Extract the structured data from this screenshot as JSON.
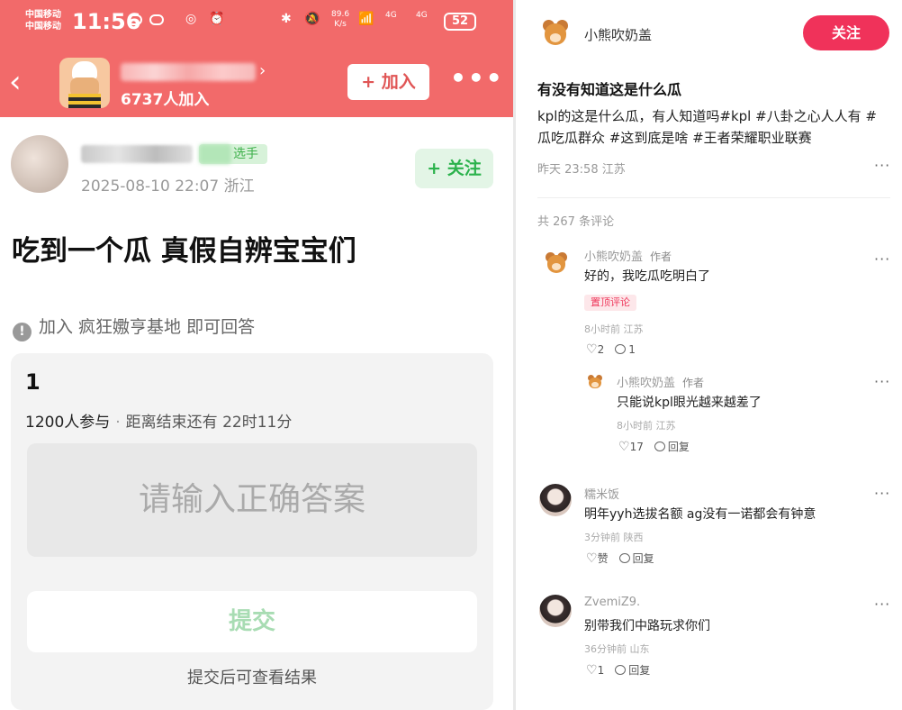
{
  "left": {
    "status_bar": {
      "carrier1": "中国移动",
      "carrier2": "中国移动",
      "time": "11:56",
      "net_speed_value": "89.6",
      "net_speed_unit": "K/s",
      "sig1": "4G",
      "sig2": "4G",
      "battery": "52"
    },
    "group": {
      "member_count": "6737人加入",
      "join_label": "+ 加入",
      "more_label": "•••"
    },
    "post": {
      "user_tag": "选手",
      "meta": "2025-08-10 22:07 浙江",
      "follow_label": "+ 关注",
      "title": "吃到一个瓜 真假自辨宝宝们",
      "notice": "加入 疯狂嫐亨基地 即可回答"
    },
    "quiz": {
      "number": "1",
      "participants": "1200人参与",
      "remaining": "距离结束还有 22时11分",
      "answer_placeholder": "请输入正确答案",
      "submit_label": "提交",
      "after_submit": "提交后可查看结果"
    }
  },
  "right": {
    "author": "小熊吹奶盖",
    "follow_label": "关注",
    "title": "有没有知道这是什么瓜",
    "body": "kpl的这是什么瓜，有人知道吗#kpl #八卦之心人人有 #瓜吃瓜群众 #这到底是啥 #王者荣耀职业联赛",
    "meta": "昨天 23:58 江苏",
    "total_comments": "共 267 条评论",
    "comments": [
      {
        "name": "小熊吹奶盖",
        "tag": "作者",
        "text": "好的，我吃瓜吃明白了",
        "pin": "置顶评论",
        "meta": "8小时前 江苏",
        "likes": "2",
        "replies": "1"
      },
      {
        "name": "小熊吹奶盖",
        "tag": "作者",
        "text": "只能说kpl眼光越来越差了",
        "meta": "8小时前 江苏",
        "likes": "17",
        "replies": "回复"
      },
      {
        "name": "糯米饭",
        "text": "明年yyh选拔名额 ag没有一诺都会有钟意",
        "meta": "3分钟前 陕西",
        "likes": "赞",
        "replies": "回复"
      },
      {
        "name": "ZvemiZ9.",
        "text": "别带我们中路玩求你们",
        "meta": "36分钟前 山东",
        "likes": "1",
        "replies": "回复"
      }
    ]
  }
}
